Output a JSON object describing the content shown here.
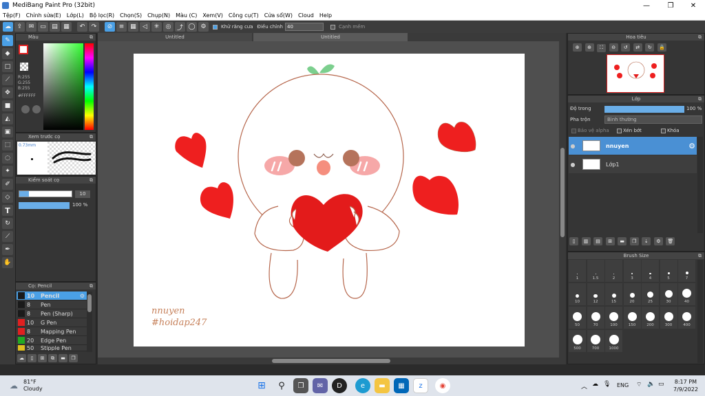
{
  "window": {
    "title": "MediBang Paint Pro (32bit)",
    "minimize": "—",
    "maximize": "❐",
    "close": "✕"
  },
  "menu": [
    "Tệp(F)",
    "Chỉnh sửa(E)",
    "Lớp(L)",
    "Bộ lọc(R)",
    "Chọn(S)",
    "Chụp(N)",
    "Màu (C)",
    "Xem(V)",
    "Công cụ(T)",
    "Cửa sổ(W)",
    "Cloud",
    "Help"
  ],
  "toolbar": {
    "antialias_label": "Khử răng cưa",
    "adjust_label": "Điều chỉnh",
    "adjust_value": "40",
    "smooth_label": "Cạnh mềm"
  },
  "tabs": [
    "Untitled",
    "Untitled"
  ],
  "color_panel": {
    "title": "Màu",
    "r": "R:255",
    "g": "G:255",
    "b": "B:255",
    "hex": "#FFFFFF"
  },
  "brush_preview": {
    "title": "Xem trước cọ",
    "size": "0.73mm"
  },
  "brush_control": {
    "title": "Kiểm soát cọ",
    "size_value": "10",
    "opacity_value": "100 %"
  },
  "brush_list": {
    "title": "Cọ: Pencil",
    "items": [
      {
        "size": "10",
        "name": "Pencil",
        "color": "#1a1a1a"
      },
      {
        "size": "8",
        "name": "Pen",
        "color": "#1a1a1a"
      },
      {
        "size": "8",
        "name": "Pen (Sharp)",
        "color": "#1a1a1a"
      },
      {
        "size": "10",
        "name": "G Pen",
        "color": "#e02020"
      },
      {
        "size": "8",
        "name": "Mapping Pen",
        "color": "#e02020"
      },
      {
        "size": "20",
        "name": "Edge Pen",
        "color": "#22aa22"
      },
      {
        "size": "50",
        "name": "Stipple Pen",
        "color": "#e0c020"
      }
    ]
  },
  "navigator": {
    "title": "Hoa tiêu"
  },
  "layer_panel": {
    "title": "Lớp",
    "opacity_label": "Độ trong",
    "opacity_value": "100 %",
    "blend_label": "Pha trộn",
    "blend_value": "Bình thường",
    "protect_alpha": "Bảo vệ alpha",
    "clipping": "Xén bớt",
    "lock": "Khóa",
    "layers": [
      {
        "name": "nnuyen",
        "selected": true
      },
      {
        "name": "Lớp1",
        "selected": false
      }
    ]
  },
  "brush_size": {
    "title": "Brush Size",
    "sizes": [
      "1",
      "1.5",
      "2",
      "3",
      "4",
      "5",
      "7",
      "10",
      "12",
      "15",
      "20",
      "25",
      "30",
      "40",
      "50",
      "70",
      "100",
      "150",
      "200",
      "300",
      "400",
      "500",
      "700",
      "1000"
    ]
  },
  "canvas": {
    "signature_line1": "nnuyen",
    "signature_line2": "#hoidap247"
  },
  "taskbar": {
    "weather_temp": "81°F",
    "weather_desc": "Cloudy",
    "lang": "ENG",
    "time": "8:17 PM",
    "date": "7/9/2022"
  }
}
